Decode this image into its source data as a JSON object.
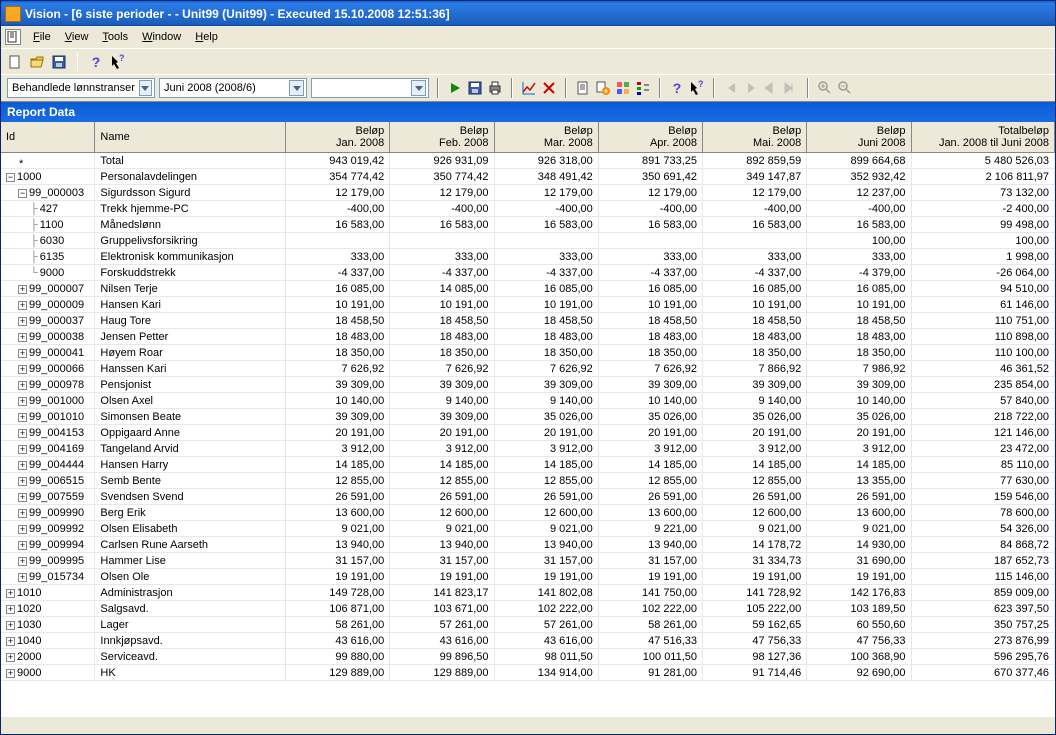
{
  "titlebar": "Vision - [6 siste perioder -  - Unit99 (Unit99) - Executed 15.10.2008 12:51:36]",
  "menus": {
    "file": "File",
    "view": "View",
    "tools": "Tools",
    "window": "Window",
    "help": "Help"
  },
  "toolbar2": {
    "combo1": "Behandlede lønnstranser",
    "combo2": "Juni 2008 (2008/6)"
  },
  "report_header": "Report Data",
  "columns": {
    "id": "Id",
    "name": "Name",
    "amount": "Beløp",
    "m1": "Jan. 2008",
    "m2": "Feb. 2008",
    "m3": "Mar. 2008",
    "m4": "Apr. 2008",
    "m5": "Mai. 2008",
    "m6": "Juni 2008",
    "total_top": "Totalbeløp",
    "total_sub": "Jan. 2008 til Juni 2008"
  },
  "rows": [
    {
      "lvl": 0,
      "exp": "",
      "id": "*",
      "name": "Total",
      "v": [
        "943 019,42",
        "926 931,09",
        "926 318,00",
        "891 733,25",
        "892 859,59",
        "899 664,68",
        "5 480 526,03"
      ]
    },
    {
      "lvl": 0,
      "exp": "-",
      "id": "1000",
      "name": "Personalavdelingen",
      "v": [
        "354 774,42",
        "350 774,42",
        "348 491,42",
        "350 691,42",
        "349 147,87",
        "352 932,42",
        "2 106 811,97"
      ]
    },
    {
      "lvl": 1,
      "exp": "-",
      "id": "99_000003",
      "name": "Sigurdsson Sigurd",
      "v": [
        "12 179,00",
        "12 179,00",
        "12 179,00",
        "12 179,00",
        "12 179,00",
        "12 237,00",
        "73 132,00"
      ]
    },
    {
      "lvl": 2,
      "exp": "l",
      "id": "427",
      "name": "Trekk hjemme-PC",
      "v": [
        "-400,00",
        "-400,00",
        "-400,00",
        "-400,00",
        "-400,00",
        "-400,00",
        "-2 400,00"
      ]
    },
    {
      "lvl": 2,
      "exp": "l",
      "id": "1100",
      "name": "Månedslønn",
      "v": [
        "16 583,00",
        "16 583,00",
        "16 583,00",
        "16 583,00",
        "16 583,00",
        "16 583,00",
        "99 498,00"
      ]
    },
    {
      "lvl": 2,
      "exp": "l",
      "id": "6030",
      "name": "Gruppelivsforsikring",
      "v": [
        "",
        "",
        "",
        "",
        "",
        "100,00",
        "100,00"
      ]
    },
    {
      "lvl": 2,
      "exp": "l",
      "id": "6135",
      "name": "Elektronisk kommunikasjon",
      "v": [
        "333,00",
        "333,00",
        "333,00",
        "333,00",
        "333,00",
        "333,00",
        "1 998,00"
      ]
    },
    {
      "lvl": 2,
      "exp": "L",
      "id": "9000",
      "name": "Forskuddstrekk",
      "v": [
        "-4 337,00",
        "-4 337,00",
        "-4 337,00",
        "-4 337,00",
        "-4 337,00",
        "-4 379,00",
        "-26 064,00"
      ]
    },
    {
      "lvl": 1,
      "exp": "+",
      "id": "99_000007",
      "name": "Nilsen Terje",
      "v": [
        "16 085,00",
        "14 085,00",
        "16 085,00",
        "16 085,00",
        "16 085,00",
        "16 085,00",
        "94 510,00"
      ]
    },
    {
      "lvl": 1,
      "exp": "+",
      "id": "99_000009",
      "name": "Hansen Kari",
      "v": [
        "10 191,00",
        "10 191,00",
        "10 191,00",
        "10 191,00",
        "10 191,00",
        "10 191,00",
        "61 146,00"
      ]
    },
    {
      "lvl": 1,
      "exp": "+",
      "id": "99_000037",
      "name": "Haug Tore",
      "v": [
        "18 458,50",
        "18 458,50",
        "18 458,50",
        "18 458,50",
        "18 458,50",
        "18 458,50",
        "110 751,00"
      ]
    },
    {
      "lvl": 1,
      "exp": "+",
      "id": "99_000038",
      "name": "Jensen Petter",
      "v": [
        "18 483,00",
        "18 483,00",
        "18 483,00",
        "18 483,00",
        "18 483,00",
        "18 483,00",
        "110 898,00"
      ]
    },
    {
      "lvl": 1,
      "exp": "+",
      "id": "99_000041",
      "name": "Høyem Roar",
      "v": [
        "18 350,00",
        "18 350,00",
        "18 350,00",
        "18 350,00",
        "18 350,00",
        "18 350,00",
        "110 100,00"
      ]
    },
    {
      "lvl": 1,
      "exp": "+",
      "id": "99_000066",
      "name": "Hanssen Kari",
      "v": [
        "7 626,92",
        "7 626,92",
        "7 626,92",
        "7 626,92",
        "7 866,92",
        "7 986,92",
        "46 361,52"
      ]
    },
    {
      "lvl": 1,
      "exp": "+",
      "id": "99_000978",
      "name": "Pensjonist",
      "v": [
        "39 309,00",
        "39 309,00",
        "39 309,00",
        "39 309,00",
        "39 309,00",
        "39 309,00",
        "235 854,00"
      ]
    },
    {
      "lvl": 1,
      "exp": "+",
      "id": "99_001000",
      "name": "Olsen Axel",
      "v": [
        "10 140,00",
        "9 140,00",
        "9 140,00",
        "10 140,00",
        "9 140,00",
        "10 140,00",
        "57 840,00"
      ]
    },
    {
      "lvl": 1,
      "exp": "+",
      "id": "99_001010",
      "name": "Simonsen Beate",
      "v": [
        "39 309,00",
        "39 309,00",
        "35 026,00",
        "35 026,00",
        "35 026,00",
        "35 026,00",
        "218 722,00"
      ]
    },
    {
      "lvl": 1,
      "exp": "+",
      "id": "99_004153",
      "name": "Oppigaard Anne",
      "v": [
        "20 191,00",
        "20 191,00",
        "20 191,00",
        "20 191,00",
        "20 191,00",
        "20 191,00",
        "121 146,00"
      ]
    },
    {
      "lvl": 1,
      "exp": "+",
      "id": "99_004169",
      "name": "Tangeland Arvid",
      "v": [
        "3 912,00",
        "3 912,00",
        "3 912,00",
        "3 912,00",
        "3 912,00",
        "3 912,00",
        "23 472,00"
      ]
    },
    {
      "lvl": 1,
      "exp": "+",
      "id": "99_004444",
      "name": "Hansen Harry",
      "v": [
        "14 185,00",
        "14 185,00",
        "14 185,00",
        "14 185,00",
        "14 185,00",
        "14 185,00",
        "85 110,00"
      ]
    },
    {
      "lvl": 1,
      "exp": "+",
      "id": "99_006515",
      "name": "Semb Bente",
      "v": [
        "12 855,00",
        "12 855,00",
        "12 855,00",
        "12 855,00",
        "12 855,00",
        "13 355,00",
        "77 630,00"
      ]
    },
    {
      "lvl": 1,
      "exp": "+",
      "id": "99_007559",
      "name": "Svendsen Svend",
      "v": [
        "26 591,00",
        "26 591,00",
        "26 591,00",
        "26 591,00",
        "26 591,00",
        "26 591,00",
        "159 546,00"
      ]
    },
    {
      "lvl": 1,
      "exp": "+",
      "id": "99_009990",
      "name": "Berg Erik",
      "v": [
        "13 600,00",
        "12 600,00",
        "12 600,00",
        "13 600,00",
        "12 600,00",
        "13 600,00",
        "78 600,00"
      ]
    },
    {
      "lvl": 1,
      "exp": "+",
      "id": "99_009992",
      "name": "Olsen Elisabeth",
      "v": [
        "9 021,00",
        "9 021,00",
        "9 021,00",
        "9 221,00",
        "9 021,00",
        "9 021,00",
        "54 326,00"
      ]
    },
    {
      "lvl": 1,
      "exp": "+",
      "id": "99_009994",
      "name": "Carlsen Rune Aarseth",
      "v": [
        "13 940,00",
        "13 940,00",
        "13 940,00",
        "13 940,00",
        "14 178,72",
        "14 930,00",
        "84 868,72"
      ]
    },
    {
      "lvl": 1,
      "exp": "+",
      "id": "99_009995",
      "name": "Hammer Lise",
      "v": [
        "31 157,00",
        "31 157,00",
        "31 157,00",
        "31 157,00",
        "31 334,73",
        "31 690,00",
        "187 652,73"
      ]
    },
    {
      "lvl": 1,
      "exp": "+",
      "id": "99_015734",
      "name": "Olsen Ole",
      "v": [
        "19 191,00",
        "19 191,00",
        "19 191,00",
        "19 191,00",
        "19 191,00",
        "19 191,00",
        "115 146,00"
      ]
    },
    {
      "lvl": 0,
      "exp": "+",
      "id": "1010",
      "name": "Administrasjon",
      "v": [
        "149 728,00",
        "141 823,17",
        "141 802,08",
        "141 750,00",
        "141 728,92",
        "142 176,83",
        "859 009,00"
      ]
    },
    {
      "lvl": 0,
      "exp": "+",
      "id": "1020",
      "name": "Salgsavd.",
      "v": [
        "106 871,00",
        "103 671,00",
        "102 222,00",
        "102 222,00",
        "105 222,00",
        "103 189,50",
        "623 397,50"
      ]
    },
    {
      "lvl": 0,
      "exp": "+",
      "id": "1030",
      "name": "Lager",
      "v": [
        "58 261,00",
        "57 261,00",
        "57 261,00",
        "58 261,00",
        "59 162,65",
        "60 550,60",
        "350 757,25"
      ]
    },
    {
      "lvl": 0,
      "exp": "+",
      "id": "1040",
      "name": "Innkjøpsavd.",
      "v": [
        "43 616,00",
        "43 616,00",
        "43 616,00",
        "47 516,33",
        "47 756,33",
        "47 756,33",
        "273 876,99"
      ]
    },
    {
      "lvl": 0,
      "exp": "+",
      "id": "2000",
      "name": "Serviceavd.",
      "v": [
        "99 880,00",
        "99 896,50",
        "98 011,50",
        "100 011,50",
        "98 127,36",
        "100 368,90",
        "596 295,76"
      ]
    },
    {
      "lvl": 0,
      "exp": "+",
      "id": "9000",
      "name": "HK",
      "v": [
        "129 889,00",
        "129 889,00",
        "134 914,00",
        "91 281,00",
        "91 714,46",
        "92 690,00",
        "670 377,46"
      ]
    }
  ]
}
